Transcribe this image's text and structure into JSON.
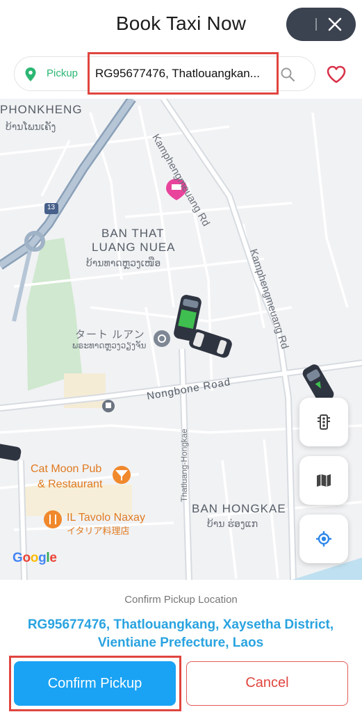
{
  "header": {
    "title": "Book Taxi Now",
    "close_icon": "close-icon"
  },
  "search": {
    "pickup_label": "Pickup",
    "address": "RG95677476, Thatlouangkan...",
    "search_icon": "search-icon",
    "favorite_icon": "heart-icon"
  },
  "map": {
    "areas": [
      {
        "name": "PHONKHENG",
        "local": "ບ້ານໂພນເຄັງ"
      },
      {
        "name": "BAN THAT",
        "name2": "LUANG NUEA",
        "local": "ບ້ານທາດຫຼວງເໜືອ"
      },
      {
        "name": "BAN HONGKAE",
        "local": "ບ້ານ ຮ່ອງແກ"
      }
    ],
    "roads": {
      "kamphengmeuang_1": "Kamphengmeuang Rd",
      "kamphengmeuang_2": "Kamphengmeuang Rd",
      "nongbone": "Nongbone Road",
      "thatluang_hongkae": "Thatluang-Hongkae",
      "route_number": "13"
    },
    "pois": {
      "temple_jp": "タート ルアン",
      "temple_local": "ພຣະທາດຫຼວງວຽງຈັນ",
      "pub_line1": "Cat Moon Pub",
      "pub_line2": "& Restaurant",
      "tavolo_line1": "IL Tavolo Naxay",
      "tavolo_line2": "イタリア料理店"
    },
    "attribution": "Google",
    "controls": [
      "traffic-icon",
      "map-layers-icon",
      "my-location-icon"
    ]
  },
  "confirm": {
    "caption": "Confirm Pickup Location",
    "address_line1": "RG95677476, Thatlouangkang, Xaysetha District,",
    "address_line2": "Vientiane Prefecture, Laos",
    "confirm_label": "Confirm Pickup",
    "cancel_label": "Cancel"
  },
  "colors": {
    "accent": "#1aa3f4",
    "pickup_green": "#2bb673",
    "cancel_red": "#e0453f",
    "highlight": "#e0453f"
  }
}
